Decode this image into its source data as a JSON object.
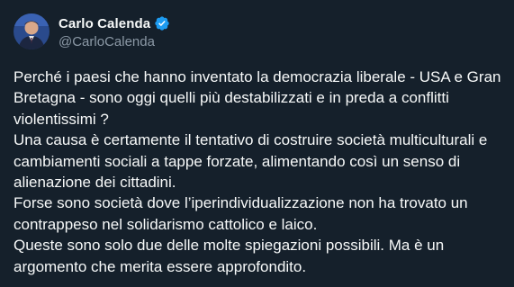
{
  "author": {
    "display_name": "Carlo Calenda",
    "handle": "@CarloCalenda",
    "verified": true,
    "verified_icon": "verified-badge-icon",
    "verified_color": "#1d9bf0"
  },
  "tweet": {
    "lines": [
      "Perché i paesi che hanno inventato la democrazia liberale - USA e Gran",
      "Bretagna - sono oggi quelli più destabilizzati e in preda a conflitti",
      "violentissimi ?",
      "Una causa è certamente il tentativo di costruire società multiculturali e",
      "cambiamenti sociali a tappe forzate, alimentando così un senso di",
      "alienazione dei cittadini.",
      "Forse sono società dove l’iperindividualizzazione non ha trovato un",
      "contrappeso nel solidarismo cattolico e laico.",
      "Queste sono solo due delle molte spiegazioni possibili. Ma è un",
      "argomento che merita essere approfondito."
    ]
  },
  "theme": {
    "background": "#15202b",
    "text": "#f7f9f9",
    "muted": "#8b98a5"
  }
}
